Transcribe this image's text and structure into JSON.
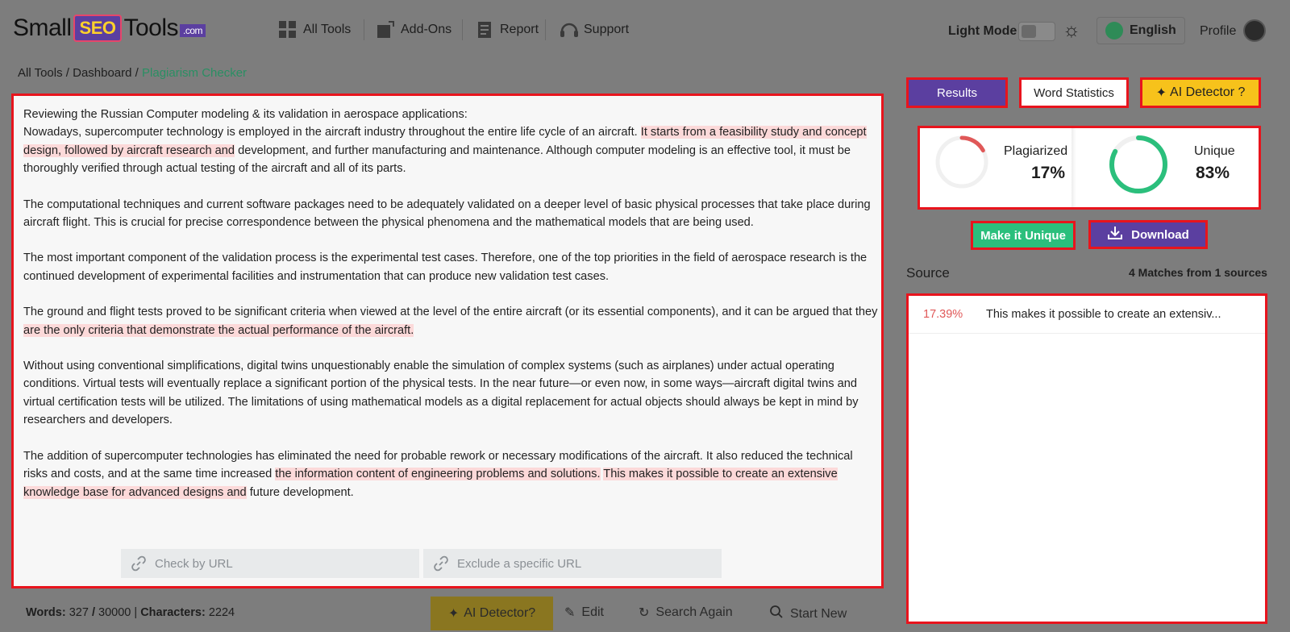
{
  "header": {
    "logo": {
      "small": "Small",
      "seo": "SEO",
      "tools": "Tools",
      "com": ".com"
    },
    "nav": [
      {
        "label": "All Tools",
        "icon": "grid-icon"
      },
      {
        "label": "Add-Ons",
        "icon": "addon-icon"
      },
      {
        "label": "Report",
        "icon": "report-icon"
      },
      {
        "label": "Support",
        "icon": "headset-icon"
      }
    ],
    "light_mode_label": "Light Mode",
    "language": "English",
    "profile_label": "Profile"
  },
  "breadcrumb": {
    "part1": "All Tools",
    "sep": " / ",
    "part2": "Dashboard",
    "current": "Plagiarism Checker"
  },
  "editor": {
    "p1_line": "Reviewing the Russian Computer modeling & its validation in aerospace applications:",
    "p1_a": "Nowadays, supercomputer technology is employed in the aircraft industry throughout the entire life cycle of an aircraft. ",
    "p1_hl": "It starts from a feasibility study and concept design, followed by aircraft research and",
    "p1_b": " development, and further manufacturing and maintenance. Although computer modeling is an effective tool, it must be thoroughly verified through actual testing of the aircraft and all of its parts.",
    "p2": "The computational techniques and current software packages need to be adequately validated on a deeper level of basic physical processes that take place during aircraft flight. This is crucial for precise correspondence between the physical phenomena and the mathematical models that are being used.",
    "p3": "The most important component of the validation process is the experimental test cases. Therefore, one of the top priorities in the field of aerospace research is the continued development of experimental facilities and instrumentation that can produce new validation test cases.",
    "p4_a": "The ground and flight tests proved to be significant criteria when viewed at the level of the entire aircraft (or its essential components), and it can be argued that they ",
    "p4_hl": "are the only criteria that demonstrate the actual performance of the aircraft.",
    "p5": "Without using conventional simplifications, digital twins unquestionably enable the simulation of complex systems (such as airplanes) under actual operating conditions. Virtual tests will eventually replace a significant portion of the physical tests. In the near future—or even now, in some ways—aircraft digital twins and virtual certification tests will be utilized. The limitations of using mathematical models as a digital replacement for actual objects should always be kept in mind by researchers and developers.",
    "p6_a": "The addition of supercomputer technologies has eliminated the need for probable rework or necessary modifications of the aircraft. It also reduced the technical risks and costs, and at the same time increased ",
    "p6_hl1": "the information content of engineering problems and solutions.",
    "p6_sp": " ",
    "p6_hl2": "This makes it possible to create an extensive knowledge base for advanced designs and",
    "p6_b": " future development.",
    "check_url_placeholder": "Check by URL",
    "exclude_url_placeholder": "Exclude a specific URL"
  },
  "footer": {
    "words_label": "Words:",
    "words_value": "327",
    "slash": "/",
    "words_limit": "30000",
    "pipe": "|",
    "chars_label": "Characters:",
    "chars_value": "2224",
    "ai_detector": "AI Detector?",
    "edit": "Edit",
    "search_again": "Search Again",
    "start_new": "Start New"
  },
  "results": {
    "tabs": {
      "results": "Results",
      "word_stats": "Word Statistics",
      "ai_detector": "AI Detector ?"
    },
    "plagiarized_label": "Plagiarized",
    "plagiarized_value": "17%",
    "plagiarized_fraction": 0.17,
    "unique_label": "Unique",
    "unique_value": "83%",
    "unique_fraction": 0.83,
    "make_unique": "Make it Unique",
    "download": "Download",
    "source_label": "Source",
    "matches_label": "4 Matches from 1 sources",
    "source_items": [
      {
        "pct": "17.39%",
        "text": "This makes it possible to create an extensiv..."
      }
    ]
  },
  "colors": {
    "accent_purple": "#5b3fa0",
    "unique_green": "#2bbf7c",
    "plag_red": "#e05858",
    "ai_yellow": "#f7c21b",
    "highlight": "#fcd9d9"
  }
}
